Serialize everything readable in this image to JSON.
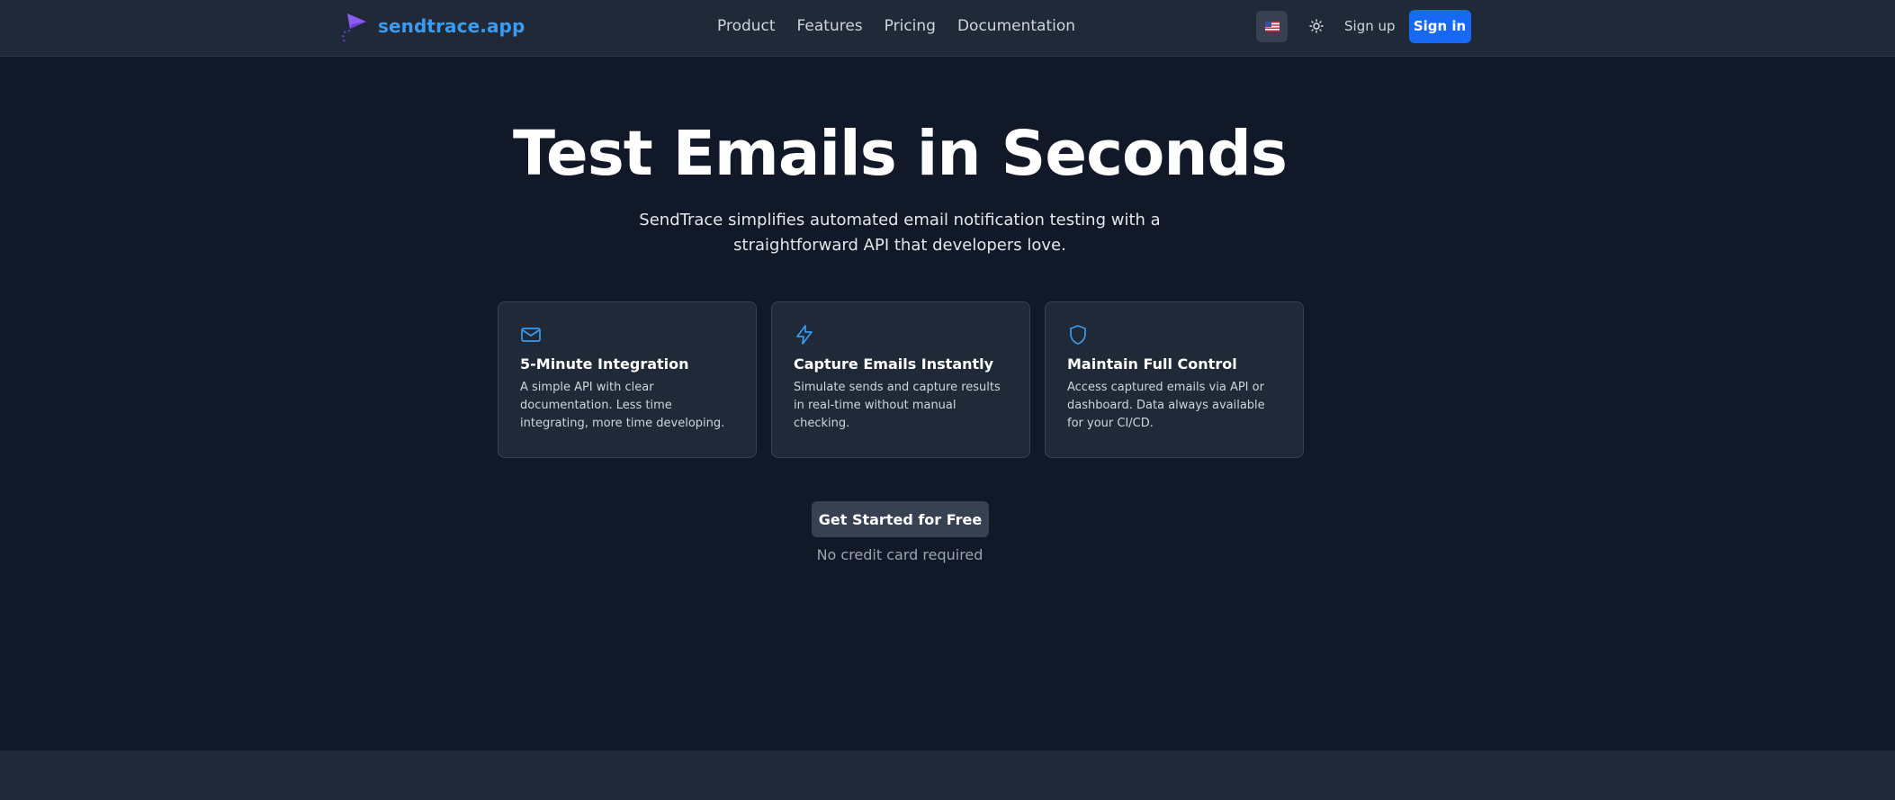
{
  "brand": {
    "name": "sendtrace.app"
  },
  "nav": {
    "items": [
      "Product",
      "Features",
      "Pricing",
      "Documentation"
    ]
  },
  "header": {
    "language_flag": "🇺🇸",
    "theme_icon": "sun-icon",
    "signup_label": "Sign up",
    "signin_label": "Sign in"
  },
  "hero": {
    "title": "Test Emails in Seconds",
    "subtitle": "SendTrace simplifies automated email notification testing with a straightforward API that developers love."
  },
  "features": [
    {
      "icon": "mail-icon",
      "title": "5-Minute Integration",
      "description": "A simple API with clear documentation. Less time integrating, more time developing."
    },
    {
      "icon": "lightning-icon",
      "title": "Capture Emails Instantly",
      "description": "Simulate sends and capture results in real-time without manual checking."
    },
    {
      "icon": "shield-icon",
      "title": "Maintain Full Control",
      "description": "Access captured emails via API or dashboard. Data always available for your CI/CD."
    }
  ],
  "cta": {
    "label": "Get Started for Free",
    "note": "No credit card required"
  },
  "colors": {
    "background": "#111827",
    "navbar": "#1f2937",
    "brand": "#3b9bf0",
    "logo_accent": "#8b5cf6",
    "primary_button": "#1769f5",
    "icon_accent": "#3b9bf0"
  }
}
